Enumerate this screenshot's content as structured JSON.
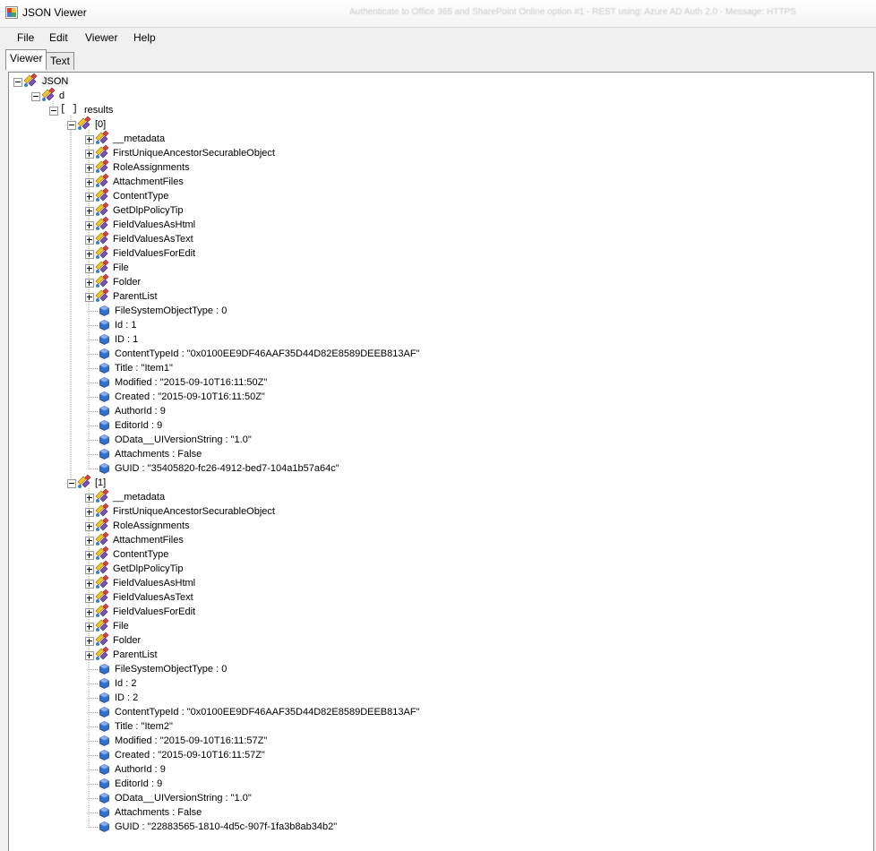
{
  "window": {
    "title": "JSON Viewer",
    "background_title": "Authenticate to Office 365 and SharePoint Online option #1 - REST using: Azure AD Auth 2.0 - Message: HTTPS"
  },
  "menu": {
    "items": [
      "File",
      "Edit",
      "Viewer",
      "Help"
    ]
  },
  "tabs": [
    {
      "label": "Viewer",
      "active": true
    },
    {
      "label": "Text",
      "active": false
    }
  ],
  "tree": {
    "root": "JSON",
    "d": "d",
    "results": "results",
    "results_icon": "[ ]",
    "items": [
      {
        "index": "[0]",
        "objects": [
          "__metadata",
          "FirstUniqueAncestorSecurableObject",
          "RoleAssignments",
          "AttachmentFiles",
          "ContentType",
          "GetDlpPolicyTip",
          "FieldValuesAsHtml",
          "FieldValuesAsText",
          "FieldValuesForEdit",
          "File",
          "Folder",
          "ParentList"
        ],
        "values": [
          "FileSystemObjectType : 0",
          "Id : 1",
          "ID : 1",
          "ContentTypeId : \"0x0100EE9DF46AAF35D44D82E8589DEEB813AF\"",
          "Title : \"Item1\"",
          "Modified : \"2015-09-10T16:11:50Z\"",
          "Created : \"2015-09-10T16:11:50Z\"",
          "AuthorId : 9",
          "EditorId : 9",
          "OData__UIVersionString : \"1.0\"",
          "Attachments : False",
          "GUID : \"35405820-fc26-4912-bed7-104a1b57a64c\""
        ]
      },
      {
        "index": "[1]",
        "objects": [
          "__metadata",
          "FirstUniqueAncestorSecurableObject",
          "RoleAssignments",
          "AttachmentFiles",
          "ContentType",
          "GetDlpPolicyTip",
          "FieldValuesAsHtml",
          "FieldValuesAsText",
          "FieldValuesForEdit",
          "File",
          "Folder",
          "ParentList"
        ],
        "values": [
          "FileSystemObjectType : 0",
          "Id : 2",
          "ID : 2",
          "ContentTypeId : \"0x0100EE9DF46AAF35D44D82E8589DEEB813AF\"",
          "Title : \"Item2\"",
          "Modified : \"2015-09-10T16:11:57Z\"",
          "Created : \"2015-09-10T16:11:57Z\"",
          "AuthorId : 9",
          "EditorId : 9",
          "OData__UIVersionString : \"1.0\"",
          "Attachments : False",
          "GUID : \"22883565-1810-4d5c-907f-1fa3b8ab34b2\""
        ]
      }
    ]
  },
  "icons": {
    "app": "json-viewer-app-icon",
    "object": "object-node-icon",
    "value": "value-node-icon",
    "expander": "tree-expander-icon"
  },
  "colors": {
    "window_bg": "#f0f0f0",
    "tree_bg": "#ffffff",
    "value_icon": "#2f6fd0",
    "object_icon_yellow": "#f2c230",
    "object_icon_purple": "#7a4fc0"
  }
}
